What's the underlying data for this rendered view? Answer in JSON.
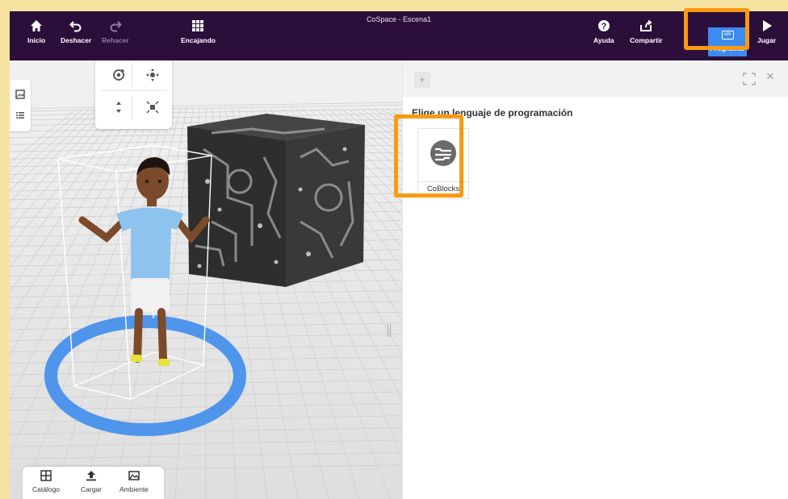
{
  "window": {
    "title": "CoSpace - Escena1"
  },
  "toolbar": {
    "home_label": "Inicio",
    "undo_label": "Deshacer",
    "redo_label": "Rehacer",
    "snap_label": "Encajando",
    "help_label": "Ayuda",
    "share_label": "Compartir",
    "code_label": "Programar",
    "code_chip": "</>",
    "play_label": "Jugar"
  },
  "bottom_tools": {
    "catalog_label": "Catálogo",
    "upload_label": "Cargar",
    "environment_label": "Ambiente"
  },
  "code_panel": {
    "add_tab_label": "+",
    "close_label": "×",
    "heading": "Elige un lenguaje de programación",
    "languages": [
      {
        "label": "CoBlocks",
        "icon": "coblocks-icon"
      }
    ]
  },
  "colors": {
    "topbar": "#2b0f3a",
    "accent_blue": "#3d8bf0",
    "highlight_orange": "#f99a12",
    "ring_blue": "#4f95ec",
    "cube": "#2e2e2e",
    "background": "#f6e3a0"
  },
  "icons": [
    "home-icon",
    "undo-icon",
    "redo-icon",
    "grid-icon",
    "help-icon",
    "share-icon",
    "play-icon",
    "gallery-icon",
    "list-icon",
    "rotate-icon",
    "move-icon",
    "height-icon",
    "scale-icon",
    "catalog-icon",
    "upload-icon",
    "environment-icon",
    "expand-icon",
    "close-icon"
  ]
}
